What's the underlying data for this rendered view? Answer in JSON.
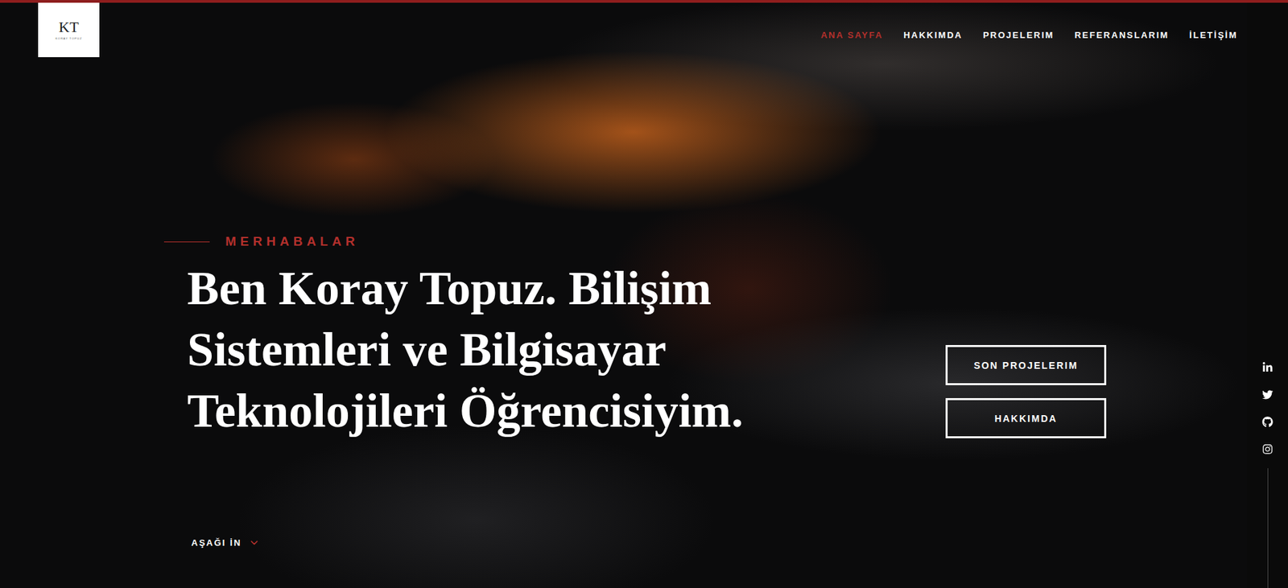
{
  "logo": {
    "initials": "KT",
    "subtitle": "KORAY TOPUZ"
  },
  "nav": [
    {
      "label": "ANA SAYFA",
      "selected": true
    },
    {
      "label": "HAKKIMDA",
      "selected": false
    },
    {
      "label": "PROJELERIM",
      "selected": false
    },
    {
      "label": "REFERANSLARIM",
      "selected": false
    },
    {
      "label": "İLETİŞİM",
      "selected": false
    }
  ],
  "hero": {
    "greeting": "MERHABALAR",
    "heading_lines": [
      "Ben Koray Topuz. Bilişim",
      "Sistemleri ve Bilgisayar",
      "Teknolojileri Öğrencisiyim."
    ]
  },
  "buttons": [
    "SON PROJELERIM",
    "HAKKIMDA"
  ],
  "scroll_hint": "AŞAĞI İN"
}
